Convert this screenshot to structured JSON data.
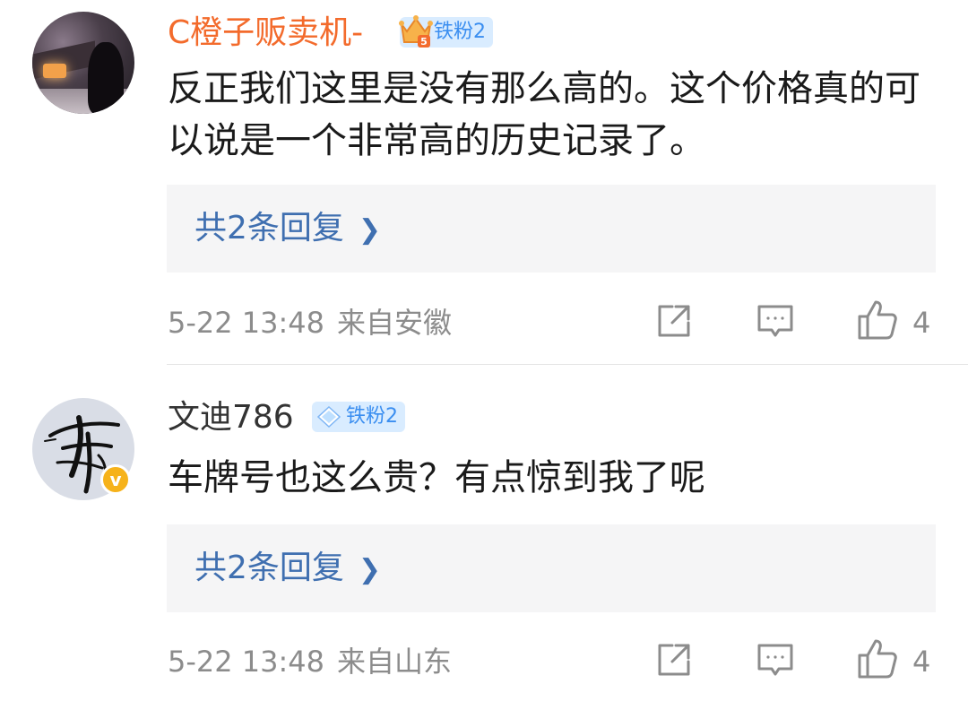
{
  "comments": [
    {
      "username": "C橙子贩卖机-",
      "fan_badge": "铁粉2",
      "crown_level": "5",
      "text": "反正我们这里是没有那么高的。这个价格真的可以说是一个非常高的历史记录了。",
      "reply_link": "共2条回复",
      "date": "5-22 13:48",
      "location": "来自安徽",
      "like_count": "4"
    },
    {
      "username": "文迪786",
      "fan_badge": "铁粉2",
      "verified_mark": "v",
      "text": "车牌号也这么贵？有点惊到我了呢",
      "reply_link": "共2条回复",
      "date": "5-22 13:48",
      "location": "来自山东",
      "like_count": "4"
    }
  ],
  "colors": {
    "username_vip": "#f36b2c",
    "username_normal": "#333333",
    "link": "#3f6fb0",
    "meta": "#8c8c8c",
    "reply_bg": "#f5f5f6",
    "badge_bg": "#d9ecff",
    "badge_text": "#3a8ef0",
    "verified": "#f6b21a"
  },
  "icons": [
    "share-icon",
    "comment-icon",
    "like-icon",
    "crown-icon",
    "diamond-icon",
    "chevron-right-icon"
  ]
}
